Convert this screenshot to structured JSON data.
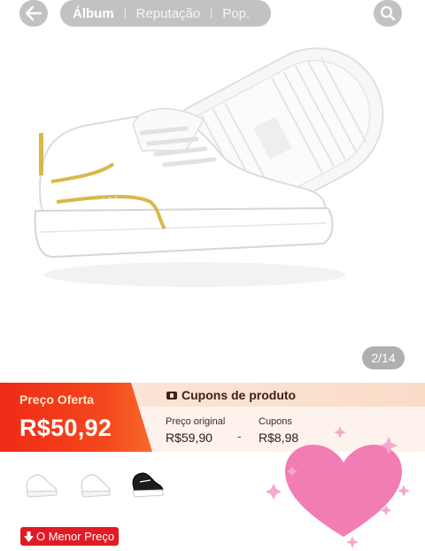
{
  "top_bar": {
    "tabs": [
      {
        "label": "Álbum",
        "active": true
      },
      {
        "label": "Reputação",
        "active": false
      },
      {
        "label": "Pop.",
        "active": false
      }
    ],
    "back_icon": "arrow-left-icon",
    "search_icon": "search-icon"
  },
  "gallery": {
    "counter": "2/14"
  },
  "price_banner": {
    "offer_label": "Preço Oferta",
    "offer_price": "R$50,92",
    "coupons_title": "Cupons de produto",
    "original_label": "Preço original",
    "original_value": "R$59,90",
    "operator": "-",
    "coupon_label": "Cupons",
    "coupon_value": "R$8,98"
  },
  "thumbnails": [
    {
      "variant": "white",
      "name": "thumb-white-1"
    },
    {
      "variant": "white",
      "name": "thumb-white-2"
    },
    {
      "variant": "black",
      "name": "thumb-black"
    }
  ],
  "badges": {
    "lowest_price": "O Menor Preço"
  },
  "colors": {
    "offer_red": "#f02a17",
    "badge_red": "#e01b26",
    "coupon_bg": "#fdf3ec",
    "heart_pink": "#f27db3"
  }
}
